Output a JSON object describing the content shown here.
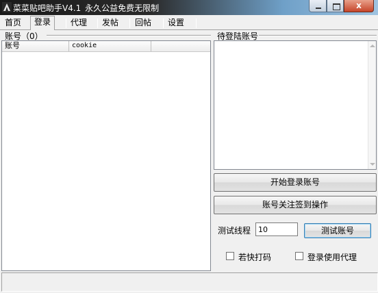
{
  "window": {
    "title": "菜菜贴吧助手V4.1",
    "subtitle": "永久公益免费无限制",
    "close_glyph": "x"
  },
  "tabs": [
    {
      "label": "首页",
      "active": false
    },
    {
      "label": "登录",
      "active": true
    },
    {
      "label": "代理",
      "active": false
    },
    {
      "label": "发帖",
      "active": false
    },
    {
      "label": "回帖",
      "active": false
    },
    {
      "label": "设置",
      "active": false
    }
  ],
  "accounts": {
    "group_label": "账号（0）",
    "columns": [
      "账号",
      "cookie",
      ""
    ],
    "rows": []
  },
  "pending": {
    "group_label": "待登陆账号",
    "content": ""
  },
  "buttons": {
    "start_login": "开始登录账号",
    "follow_sign": "账号关注签到操作",
    "test_account": "测试账号"
  },
  "thread_test": {
    "label": "测试线程",
    "value": "10"
  },
  "checkboxes": [
    {
      "label": "若快打码",
      "checked": false
    },
    {
      "label": "登录使用代理",
      "checked": false
    }
  ],
  "status_text": "",
  "colors": {
    "window_bg": "#f0f0f0",
    "close_button": "#c6452a"
  }
}
